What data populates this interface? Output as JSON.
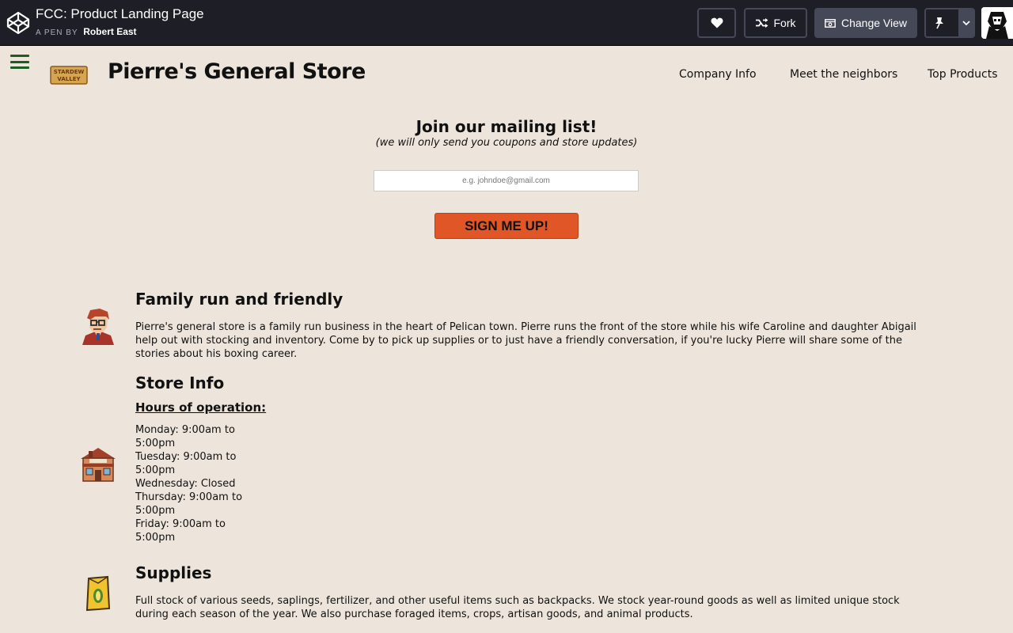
{
  "codepen": {
    "pen_title": "FCC: Product Landing Page",
    "by_label": "A PEN BY",
    "author": "Robert East",
    "fork_label": "Fork",
    "change_view_label": "Change View",
    "accent": "#1e1f26"
  },
  "header": {
    "logo_text_line1": "STARDEW",
    "logo_text_line2": "VALLEY",
    "title": "Pierre's General Store",
    "nav": [
      "Company Info",
      "Meet the neighbors",
      "Top Products"
    ],
    "menu_color": "#1d5d22"
  },
  "mailing": {
    "title": "Join our mailing list!",
    "subtitle": "(we will only send you coupons and store updates)",
    "placeholder": "e.g. johndoe@gmail.com",
    "button_label": "SIGN ME UP!",
    "button_color": "#e15626"
  },
  "sections": {
    "family": {
      "title": "Family run and friendly",
      "body": "Pierre's general store is a family run business in the heart of Pelican town. Pierre runs the front of the store while his wife Caroline and daughter Abigail help out with stocking and inventory. Come by to pick up supplies or to just have a friendly conversation, if you're lucky Pierre will share some of the stories about his boxing career."
    },
    "store": {
      "title": "Store Info",
      "hours_title": "Hours of operation:",
      "hours": [
        "Monday: 9:00am to 5:00pm",
        "Tuesday: 9:00am to 5:00pm",
        "Wednesday: Closed",
        "Thursday: 9:00am to 5:00pm",
        "Friday: 9:00am to 5:00pm"
      ]
    },
    "supplies": {
      "title": "Supplies",
      "body": "Full stock of various seeds, saplings, fertilizer, and other useful items such as backpacks. We stock year-round goods as well as limited unique stock during each season of the year. We also purchase foraged items, crops, artisan goods, and animal products."
    }
  },
  "page_background": "#ede5db"
}
